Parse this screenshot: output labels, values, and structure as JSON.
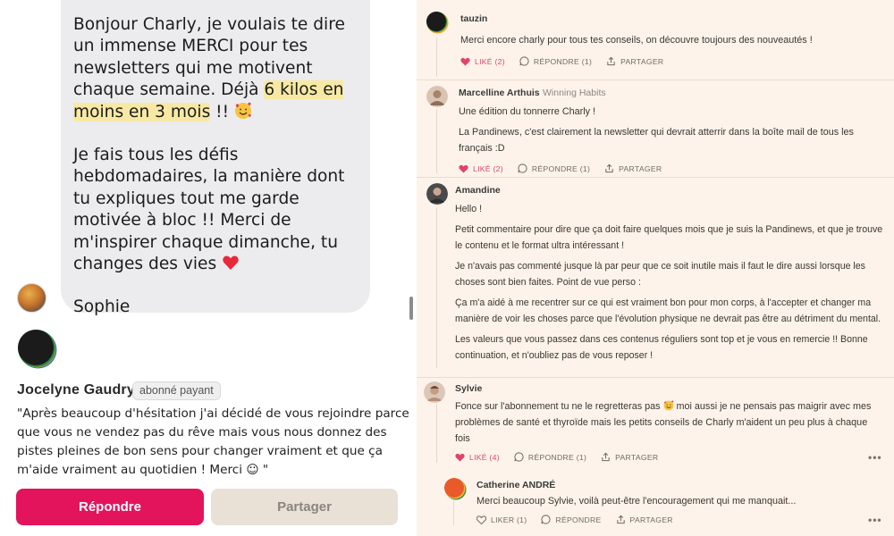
{
  "left": {
    "message": {
      "line_before_highlight": "Bonjour Charly, je voulais te dire un immense MERCI pour tes newsletters qui me motivent chaque semaine. Déjà ",
      "highlight": "6 kilos en moins en 3 mois",
      "after_highlight": " !! ",
      "paragraph2": "Je fais tous les défis hebdomadaires, la manière dont tu expliques tout me garde motivée à bloc !! Merci de m'inspirer chaque dimanche, tu changes des vies ",
      "signature": "Sophie"
    },
    "review": {
      "name": "Jocelyne Gaudry",
      "badge": "abonné payant",
      "text": "\"Après beaucoup d'hésitation j'ai décidé de vous rejoindre parce que vous ne vendez pas du rêve mais vous nous donnez des pistes pleines de bon sens pour changer vraiment et que ça m'aide vraiment au quotidien ! Merci ☺ \""
    },
    "buttons": {
      "reply": "Répondre",
      "share": "Partager"
    }
  },
  "right": {
    "comments": [
      {
        "author": "tauzin",
        "text": [
          "Merci encore charly pour tous tes conseils, on découvre toujours des nouveautés !"
        ],
        "like_label": "LIKÉ (2)",
        "reply_label": "RÉPONDRE (1)",
        "share_label": "PARTAGER"
      },
      {
        "author": "Marcelline Arthuis",
        "tag": "Winning Habits",
        "text": [
          "Une édition du tonnerre Charly !",
          "La Pandinews, c'est clairement la newsletter qui devrait atterrir dans la boîte mail de tous les français :D"
        ],
        "like_label": "LIKÉ (2)",
        "reply_label": "RÉPONDRE (1)",
        "share_label": "PARTAGER"
      },
      {
        "author": "Amandine",
        "text": [
          "Hello !",
          "Petit commentaire pour dire que ça doit faire quelques mois que je suis la Pandinews, et que je trouve le contenu et le format ultra intéressant !",
          "Je n'avais pas commenté jusque là par peur que ce soit inutile mais il faut le dire aussi lorsque les choses sont bien faites. Point de vue perso :",
          "Ça m'a aidé à me recentrer sur ce qui est vraiment bon pour mon corps, à l'accepter et changer ma manière de voir les choses parce que l'évolution physique ne devrait pas être au détriment du mental.",
          "Les valeurs que vous passez dans ces contenus réguliers sont top et je vous en remercie !! Bonne continuation, et n'oubliez pas de vous reposer !"
        ]
      },
      {
        "author": "Sylvie",
        "text_before_emoji": "Fonce sur l'abonnement tu ne le regretteras pas ",
        "text_after_emoji": " moi aussi je ne pensais pas maigrir avec mes problèmes de santé et thyroïde mais les petits conseils de Charly m'aident un peu plus à chaque fois",
        "like_label": "LIKÉ (4)",
        "reply_label": "RÉPONDRE (1)",
        "share_label": "PARTAGER",
        "more": "•••"
      },
      {
        "author": "Catherine ANDRÉ",
        "text": [
          "Merci beaucoup Sylvie, voilà peut-être l'encouragement qui me manquait..."
        ],
        "like_label": "LIKER (1)",
        "reply_label": "RÉPONDRE",
        "share_label": "PARTAGER",
        "more": "•••"
      }
    ]
  },
  "colors": {
    "accent": "#e3135c",
    "liked": "#e0446a",
    "right_bg": "#fdf3ea",
    "highlight": "#f7e9a3"
  }
}
